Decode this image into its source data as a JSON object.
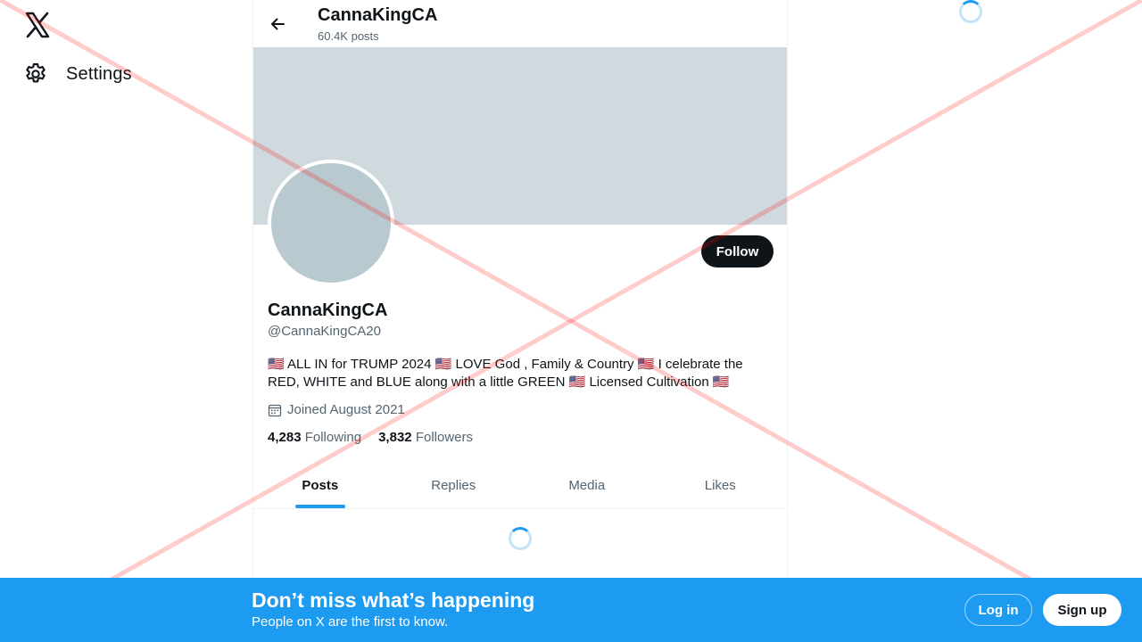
{
  "nav": {
    "logo_icon": "x-logo-icon",
    "settings_label": "Settings",
    "settings_icon": "gear-icon"
  },
  "header": {
    "name": "CannaKingCA",
    "posts_count": "60.4K posts",
    "back_icon": "back-arrow-icon"
  },
  "profile": {
    "display_name": "CannaKingCA",
    "handle": "@CannaKingCA20",
    "follow_label": "Follow",
    "bio": "🇺🇸 ALL IN for TRUMP 2024 🇺🇸 LOVE God , Family & Country 🇺🇸 I celebrate the RED, WHITE and BLUE along with a little GREEN 🇺🇸 Licensed Cultivation 🇺🇸",
    "joined": "Joined August 2021",
    "joined_icon": "calendar-icon",
    "following_count": "4,283",
    "following_label": "Following",
    "followers_count": "3,832",
    "followers_label": "Followers"
  },
  "tabs": [
    {
      "label": "Posts",
      "active": true
    },
    {
      "label": "Replies",
      "active": false
    },
    {
      "label": "Media",
      "active": false
    },
    {
      "label": "Likes",
      "active": false
    }
  ],
  "bottom_bar": {
    "title": "Don’t miss what’s happening",
    "subtitle": "People on X are the first to know.",
    "login_label": "Log in",
    "signup_label": "Sign up"
  },
  "colors": {
    "accent": "#1d9bf0",
    "text_primary": "#0f1419",
    "text_secondary": "#536471",
    "banner": "#cfd9de",
    "avatar": "#b9c9d0",
    "watermark": "#ff0000"
  }
}
